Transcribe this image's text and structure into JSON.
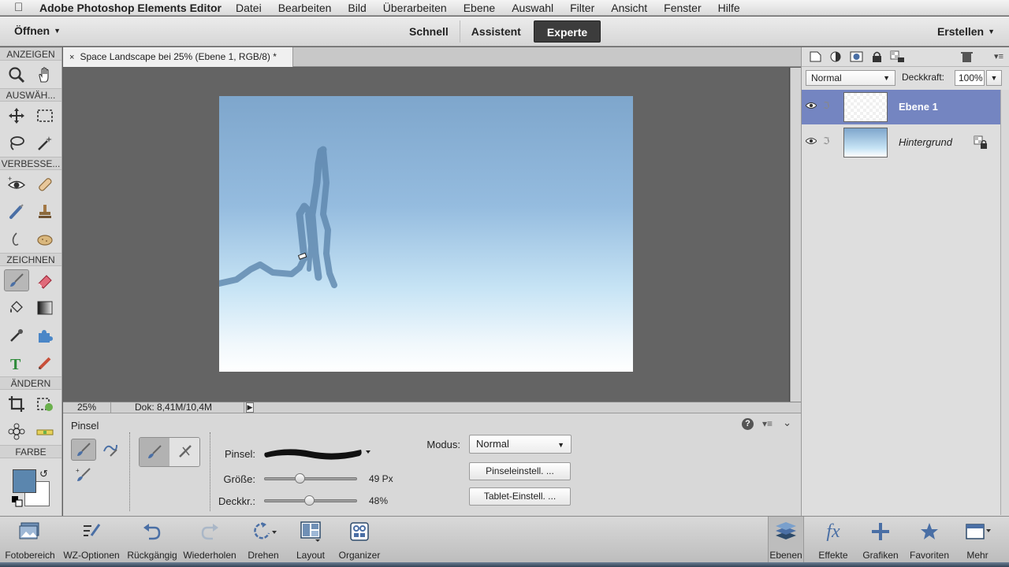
{
  "menubar": {
    "app_name": "Adobe Photoshop Elements Editor",
    "items": [
      "Datei",
      "Bearbeiten",
      "Bild",
      "Überarbeiten",
      "Ebene",
      "Auswahl",
      "Filter",
      "Ansicht",
      "Fenster",
      "Hilfe"
    ]
  },
  "topbar": {
    "open_label": "Öffnen",
    "modes": [
      "Schnell",
      "Assistent",
      "Experte"
    ],
    "active_mode": "Experte",
    "create_label": "Erstellen"
  },
  "tools": {
    "sections": {
      "view": "ANZEIGEN",
      "select": "AUSWÄH...",
      "enhance": "VERBESSE...",
      "draw": "ZEICHNEN",
      "modify": "ÄNDERN",
      "color": "FARBE"
    },
    "foreground_color": "#5b86ae",
    "background_color": "#ffffff"
  },
  "document": {
    "tab_title": "Space Landscape bei 25% (Ebene 1, RGB/8) *",
    "close_glyph": "×"
  },
  "status": {
    "zoom": "25%",
    "doc_size": "Dok: 8,41M/10,4M"
  },
  "options": {
    "title": "Pinsel",
    "brush_label": "Pinsel:",
    "size_label": "Größe:",
    "size_value": "49 Px",
    "size_fraction": 0.36,
    "opacity_label": "Deckkr.:",
    "opacity_value": "48%",
    "opacity_fraction": 0.48,
    "mode_label": "Modus:",
    "mode_value": "Normal",
    "brush_settings_button": "Pinseleinstell. ...",
    "tablet_settings_button": "Tablet-Einstell. ..."
  },
  "layers": {
    "blend_mode": "Normal",
    "opacity_label": "Deckkraft:",
    "opacity_value": "100%",
    "items": [
      {
        "name": "Ebene 1",
        "selected": true
      },
      {
        "name": "Hintergrund",
        "selected": false
      }
    ]
  },
  "bottombar": {
    "left": [
      "Fotobereich",
      "WZ-Optionen",
      "Rückgängig",
      "Wiederholen",
      "Drehen",
      "Layout",
      "Organizer"
    ],
    "right": [
      "Ebenen",
      "Effekte",
      "Grafiken",
      "Favoriten",
      "Mehr"
    ]
  }
}
